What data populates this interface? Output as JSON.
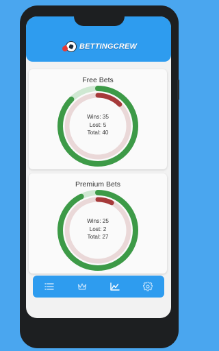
{
  "app": {
    "title": "BETTINGCREW"
  },
  "colors": {
    "background": "#4aa6ef",
    "appbar": "#2e9cef",
    "win": "#3d9a47",
    "win_light": "#cfe8d2",
    "loss": "#a63a3a",
    "loss_light": "#ead8d8"
  },
  "cards": [
    {
      "title": "Free Bets",
      "wins_label": "Wins: 35",
      "lost_label": "Lost: 5",
      "total_label": "Total: 40",
      "wins": 35,
      "lost": 5,
      "total": 40
    },
    {
      "title": "Premium Bets",
      "wins_label": "Wins: 25",
      "lost_label": "Lost: 2",
      "total_label": "Total: 27",
      "wins": 25,
      "lost": 2,
      "total": 27
    }
  ],
  "nav": {
    "items": [
      {
        "icon": "list-icon",
        "active": false
      },
      {
        "icon": "crown-icon",
        "active": false
      },
      {
        "icon": "chart-icon",
        "active": true
      },
      {
        "icon": "gear-icon",
        "active": false
      }
    ]
  }
}
